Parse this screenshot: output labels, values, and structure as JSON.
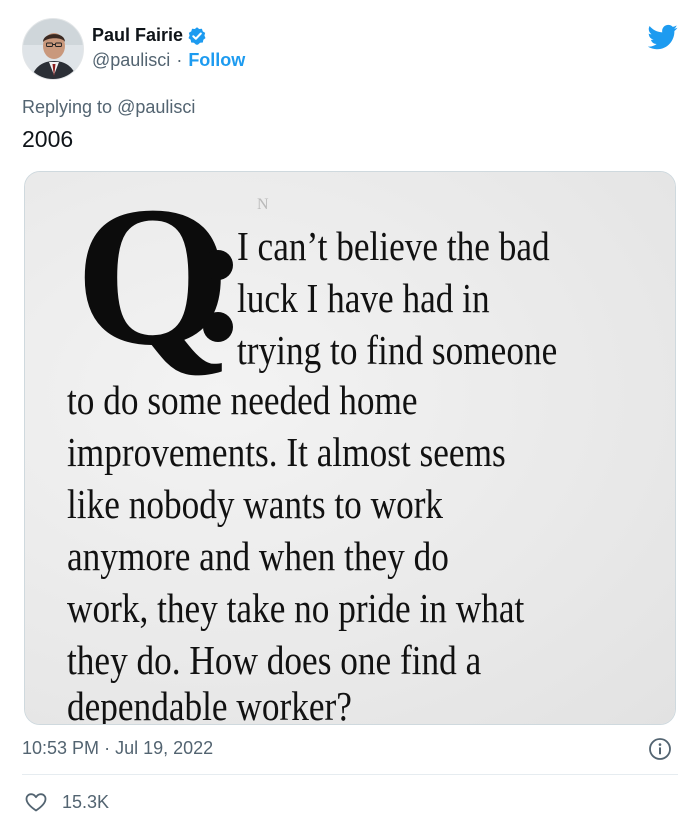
{
  "author": {
    "name": "Paul Fairie",
    "handle": "@paulisci",
    "follow_label": "Follow",
    "separator": "·"
  },
  "reply": {
    "prefix": "Replying to",
    "mention": "@paulisci"
  },
  "tweet": {
    "text": "2006"
  },
  "clipping": {
    "q_letter": "Q",
    "faint_mark": "N",
    "lines": [
      "I can’t believe the bad",
      "luck I have had in",
      "trying to find someone",
      "to do some needed home",
      "improvements. It almost seems",
      "like nobody wants to work",
      "anymore and when they do",
      "work, they take no pride in what",
      "they do. How does one find a",
      "dependable worker?"
    ]
  },
  "meta": {
    "time": "10:53 PM",
    "separator": "·",
    "date": "Jul 19, 2022"
  },
  "engagement": {
    "likes": "15.3K"
  },
  "colors": {
    "accent": "#1d9bf0",
    "muted_text": "#536471",
    "primary_text": "#0f1419"
  },
  "icons": {
    "verified": "verified-badge-icon",
    "brand": "twitter-bird-icon",
    "info": "info-icon",
    "like": "heart-icon"
  }
}
